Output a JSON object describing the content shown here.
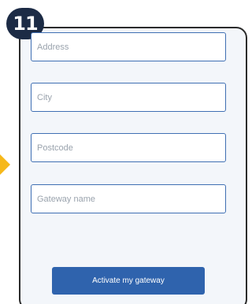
{
  "step": {
    "number": "11"
  },
  "form": {
    "address": {
      "placeholder": "Address",
      "value": ""
    },
    "city": {
      "placeholder": "City",
      "value": ""
    },
    "postcode": {
      "placeholder": "Postcode",
      "value": ""
    },
    "gateway_name": {
      "placeholder": "Gateway name",
      "value": ""
    },
    "submit_label": "Activate my gateway"
  },
  "colors": {
    "accent": "#2f63ad",
    "badge": "#1c2b45",
    "arrow": "#f6b81a",
    "field_border": "#3f6fb3",
    "panel_background": "#f3f6fa"
  },
  "icons": {
    "pointer": "arrow-right-icon"
  }
}
